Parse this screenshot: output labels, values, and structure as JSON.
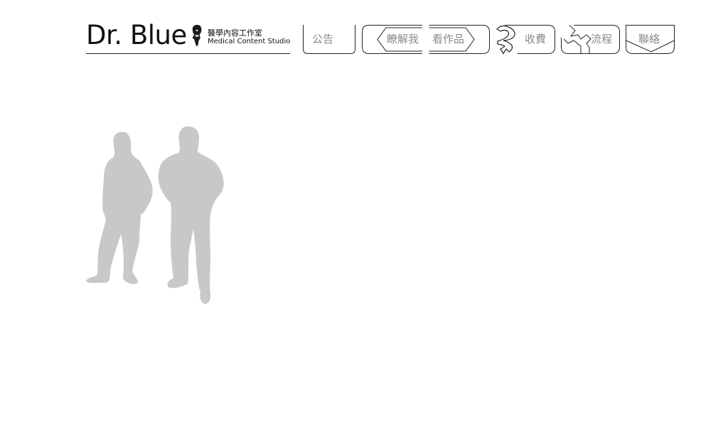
{
  "logo": {
    "title": "Dr. Blue",
    "subtitle_cn": "醫學內容工作室",
    "subtitle_en": "Medical Content Studio"
  },
  "nav": {
    "items": [
      {
        "id": "announcements",
        "label": "公告",
        "icon": "tab-outline-icon"
      },
      {
        "id": "about",
        "label": "瞭解我",
        "icon": "arrow-left-outline-icon"
      },
      {
        "id": "portfolio",
        "label": "看作品",
        "icon": "arrow-right-outline-icon"
      },
      {
        "id": "pricing",
        "label": "收費",
        "icon": "swirl-arrow-icon"
      },
      {
        "id": "process",
        "label": "流程",
        "icon": "zigzag-arrow-icon"
      },
      {
        "id": "contact",
        "label": "聯絡",
        "icon": "envelope-icon"
      }
    ]
  },
  "hero": {
    "image": "two-people-silhouette",
    "color": "#c8c8c8"
  },
  "colors": {
    "text": "#111111",
    "nav_label": "#8a8a8a",
    "outline": "#222222",
    "silhouette": "#c8c8c8"
  }
}
